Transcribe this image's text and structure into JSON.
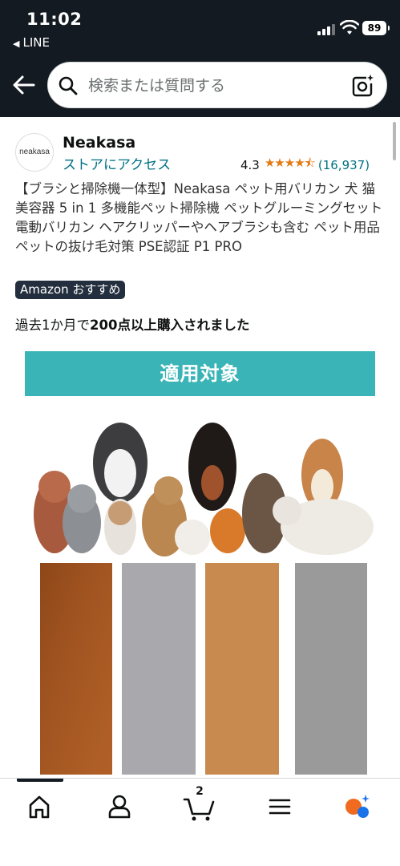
{
  "status_bar": {
    "time": "11:02",
    "back_app": "LINE",
    "battery": "89"
  },
  "search": {
    "placeholder": "検索または質問する"
  },
  "product": {
    "brand_logo_text": "neakasa",
    "brand_name": "Neakasa",
    "store_link": "ストアにアクセス",
    "rating": "4.3",
    "review_count": "(16,937)",
    "title": "【ブラシと掃除機一体型】Neakasa ペット用バリカン 犬 猫美容器 5 in 1 多機能ペット掃除機 ペットグルーミングセット 電動バリカン ヘアクリッパーやヘアブラシも含む ペット用品 ペットの抜け毛対策 PSE認証 P1 PRO",
    "badge": "Amazon おすすめ",
    "purchased_prefix": "過去1か月で",
    "purchased_bold": "200点以上購入されました",
    "banner_text": "適用対象"
  },
  "bottom_nav": {
    "cart_count": "2"
  },
  "colors": {
    "header_bg": "#131a22",
    "link": "#007185",
    "star": "#e47911",
    "banner": "#3ab4b6"
  }
}
